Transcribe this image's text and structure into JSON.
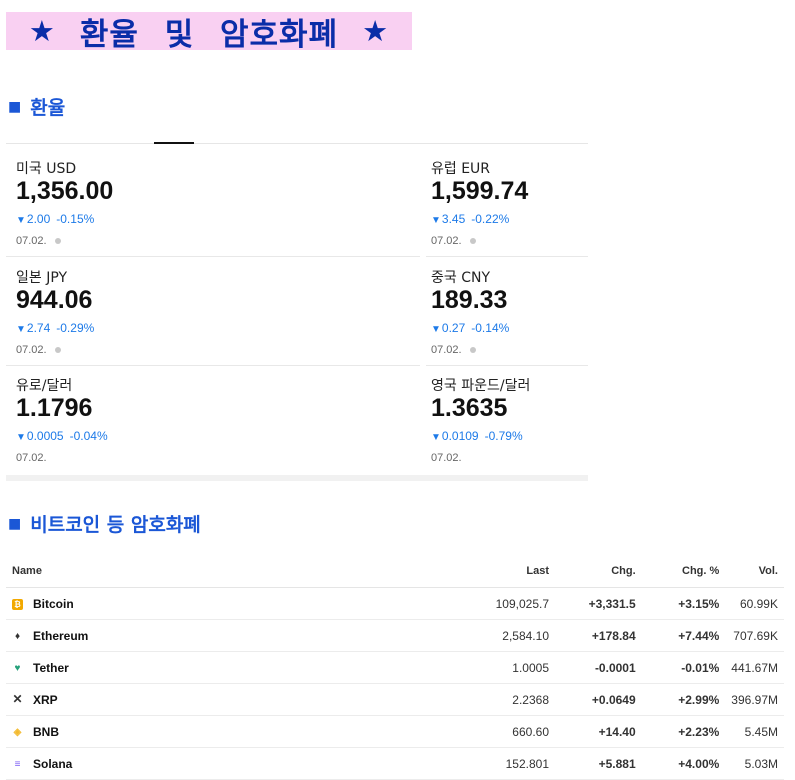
{
  "banner": {
    "star_left": "★",
    "title": "환율 및 암호화폐",
    "star_right": "★"
  },
  "fx_section": {
    "marker": "■",
    "title": "환율"
  },
  "crypto_section": {
    "marker": "■",
    "title": "비트코인 등 암호화폐"
  },
  "fx": [
    {
      "name": "미국 USD",
      "value": "1,356.00",
      "arrow": "▼",
      "change": "2.00",
      "pct": "-0.15%",
      "date": "07.02.",
      "dot": true
    },
    {
      "name": "유럽 EUR",
      "value": "1,599.74",
      "arrow": "▼",
      "change": "3.45",
      "pct": "-0.22%",
      "date": "07.02.",
      "dot": true
    },
    {
      "name": "일본 JPY",
      "value": "944.06",
      "arrow": "▼",
      "change": "2.74",
      "pct": "-0.29%",
      "date": "07.02.",
      "dot": true
    },
    {
      "name": "중국 CNY",
      "value": "189.33",
      "arrow": "▼",
      "change": "0.27",
      "pct": "-0.14%",
      "date": "07.02.",
      "dot": true
    },
    {
      "name": "유로/달러",
      "value": "1.1796",
      "arrow": "▼",
      "change": "0.0005",
      "pct": "-0.04%",
      "date": "07.02.",
      "dot": false
    },
    {
      "name": "영국 파운드/달러",
      "value": "1.3635",
      "arrow": "▼",
      "change": "0.0109",
      "pct": "-0.79%",
      "date": "07.02.",
      "dot": false
    }
  ],
  "crypto": {
    "headers": {
      "name": "Name",
      "last": "Last",
      "chg": "Chg.",
      "chg_pct": "Chg. %",
      "vol": "Vol."
    },
    "rows": [
      {
        "icon": "bitcoin-icon",
        "name": "Bitcoin",
        "last": "109,025.7",
        "chg": "+3,331.5",
        "chg_pct": "+3.15%",
        "vol": "60.99K",
        "dir": "pos"
      },
      {
        "icon": "ethereum-icon",
        "name": "Ethereum",
        "last": "2,584.10",
        "chg": "+178.84",
        "chg_pct": "+7.44%",
        "vol": "707.69K",
        "dir": "pos"
      },
      {
        "icon": "tether-icon",
        "name": "Tether",
        "last": "1.0005",
        "chg": "-0.0001",
        "chg_pct": "-0.01%",
        "vol": "441.67M",
        "dir": "neg"
      },
      {
        "icon": "xrp-icon",
        "name": "XRP",
        "last": "2.2368",
        "chg": "+0.0649",
        "chg_pct": "+2.99%",
        "vol": "396.97M",
        "dir": "pos"
      },
      {
        "icon": "bnb-icon",
        "name": "BNB",
        "last": "660.60",
        "chg": "+14.40",
        "chg_pct": "+2.23%",
        "vol": "5.45M",
        "dir": "pos"
      },
      {
        "icon": "solana-icon",
        "name": "Solana",
        "last": "152.801",
        "chg": "+5.881",
        "chg_pct": "+4.00%",
        "vol": "5.03M",
        "dir": "pos"
      }
    ]
  },
  "colors": {
    "banner_bg": "#f9d0f2",
    "banner_text": "#0a2da8",
    "section_blue": "#1b57d6",
    "down_blue": "#1d7ae8",
    "up_green": "#138a3c",
    "down_red": "#d81f1f"
  }
}
